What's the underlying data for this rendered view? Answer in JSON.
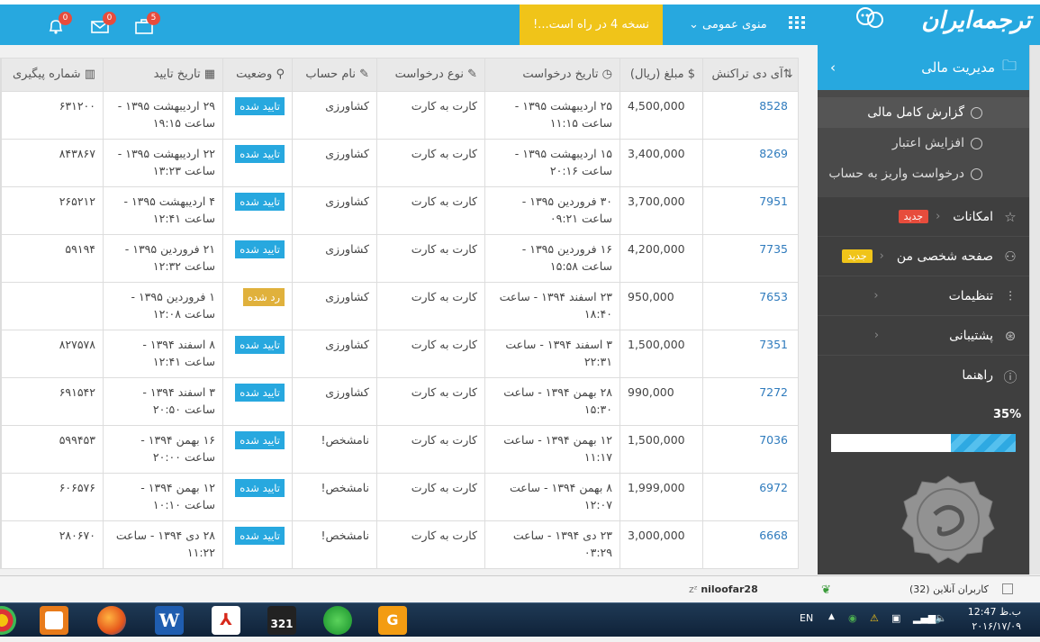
{
  "header": {
    "logo_text": "ترجمه‌ایران",
    "menu_label": "منوی عمومی",
    "banner": "نسخه 4 در راه است...!",
    "badges": {
      "notifications": "0",
      "messages": "0",
      "tasks": "5"
    }
  },
  "sidebar": {
    "section_title": "مدیریت مالی",
    "sub_items": [
      "گزارش کامل مالی",
      "افزایش اعتبار",
      "درخواست واریز به حساب"
    ],
    "items": [
      {
        "label": "امکانات",
        "badge": "جدید",
        "badge_color": "#e74c3c"
      },
      {
        "label": "صفحه شخصی من",
        "badge": "جدید",
        "badge_color": "#f0c419"
      },
      {
        "label": "تنظیمات",
        "badge": ""
      },
      {
        "label": "پشتیبانی",
        "badge": ""
      },
      {
        "label": "راهنما",
        "badge": ""
      }
    ],
    "progress_label": "35%",
    "progress_value": 35
  },
  "table": {
    "headers": [
      "آی دی تراکنش",
      "مبلغ (ریال)",
      "تاریخ درخواست",
      "نوع درخواست",
      "نام حساب",
      "وضعیت",
      "تاریخ تایید",
      "شماره پیگیری"
    ],
    "rows": [
      {
        "id": "8528",
        "amount": "4,500,000",
        "req_date": "۲۵ اردیبهشت ۱۳۹۵ - ساعت ۱۱:۱۵",
        "type": "کارت به کارت",
        "account": "کشاورزی",
        "status": "تایید شده",
        "rejected": false,
        "conf_date": "۲۹ اردیبهشت ۱۳۹۵ - ساعت ۱۹:۱۵",
        "track": "۶۳۱۲۰۰"
      },
      {
        "id": "8269",
        "amount": "3,400,000",
        "req_date": "۱۵ اردیبهشت ۱۳۹۵ - ساعت ۲۰:۱۶",
        "type": "کارت به کارت",
        "account": "کشاورزی",
        "status": "تایید شده",
        "rejected": false,
        "conf_date": "۲۲ اردیبهشت ۱۳۹۵ - ساعت ۱۳:۲۳",
        "track": "۸۴۳۸۶۷"
      },
      {
        "id": "7951",
        "amount": "3,700,000",
        "req_date": "۳۰ فروردین ۱۳۹۵ - ساعت ۰۹:۲۱",
        "type": "کارت به کارت",
        "account": "کشاورزی",
        "status": "تایید شده",
        "rejected": false,
        "conf_date": "۴ اردیبهشت ۱۳۹۵ - ساعت ۱۲:۴۱",
        "track": "۲۶۵۲۱۲"
      },
      {
        "id": "7735",
        "amount": "4,200,000",
        "req_date": "۱۶ فروردین ۱۳۹۵ - ساعت ۱۵:۵۸",
        "type": "کارت به کارت",
        "account": "کشاورزی",
        "status": "تایید شده",
        "rejected": false,
        "conf_date": "۲۱ فروردین ۱۳۹۵ - ساعت ۱۲:۳۲",
        "track": "۵۹۱۹۴"
      },
      {
        "id": "7653",
        "amount": "950,000",
        "req_date": "۲۳ اسفند ۱۳۹۴ - ساعت ۱۸:۴۰",
        "type": "کارت به کارت",
        "account": "کشاورزی",
        "status": "رد شده",
        "rejected": true,
        "conf_date": "۱ فروردین ۱۳۹۵ - ساعت ۱۲:۰۸",
        "track": ""
      },
      {
        "id": "7351",
        "amount": "1,500,000",
        "req_date": "۳ اسفند ۱۳۹۴ - ساعت ۲۲:۳۱",
        "type": "کارت به کارت",
        "account": "کشاورزی",
        "status": "تایید شده",
        "rejected": false,
        "conf_date": "۸ اسفند ۱۳۹۴ - ساعت ۱۲:۴۱",
        "track": "۸۲۷۵۷۸"
      },
      {
        "id": "7272",
        "amount": "990,000",
        "req_date": "۲۸ بهمن ۱۳۹۴ - ساعت ۱۵:۳۰",
        "type": "کارت به کارت",
        "account": "کشاورزی",
        "status": "تایید شده",
        "rejected": false,
        "conf_date": "۳ اسفند ۱۳۹۴ - ساعت ۲۰:۵۰",
        "track": "۶۹۱۵۴۲"
      },
      {
        "id": "7036",
        "amount": "1,500,000",
        "req_date": "۱۲ بهمن ۱۳۹۴ - ساعت ۱۱:۱۷",
        "type": "کارت به کارت",
        "account": "نامشخص!",
        "status": "تایید شده",
        "rejected": false,
        "conf_date": "۱۶ بهمن ۱۳۹۴ - ساعت ۲۰:۰۰",
        "track": "۵۹۹۴۵۳"
      },
      {
        "id": "6972",
        "amount": "1,999,000",
        "req_date": "۸ بهمن ۱۳۹۴ - ساعت ۱۲:۰۷",
        "type": "کارت به کارت",
        "account": "نامشخص!",
        "status": "تایید شده",
        "rejected": false,
        "conf_date": "۱۲ بهمن ۱۳۹۴ - ساعت ۱۰:۱۰",
        "track": "۶۰۶۵۷۶"
      },
      {
        "id": "6668",
        "amount": "3,000,000",
        "req_date": "۲۳ دی ۱۳۹۴ - ساعت ۰۳:۲۹",
        "type": "کارت به کارت",
        "account": "نامشخص!",
        "status": "تایید شده",
        "rejected": false,
        "conf_date": "۲۸ دی ۱۳۹۴ - ساعت ۱۱:۲۲",
        "track": "۲۸۰۶۷۰"
      }
    ]
  },
  "footer": {
    "username": "niloofar28",
    "online": "کاربران آنلاین (32)"
  },
  "taskbar": {
    "lang": "EN",
    "time": "ب.ظ 12:47",
    "date": "۲۰۱۶/۱۷/۰۹"
  }
}
